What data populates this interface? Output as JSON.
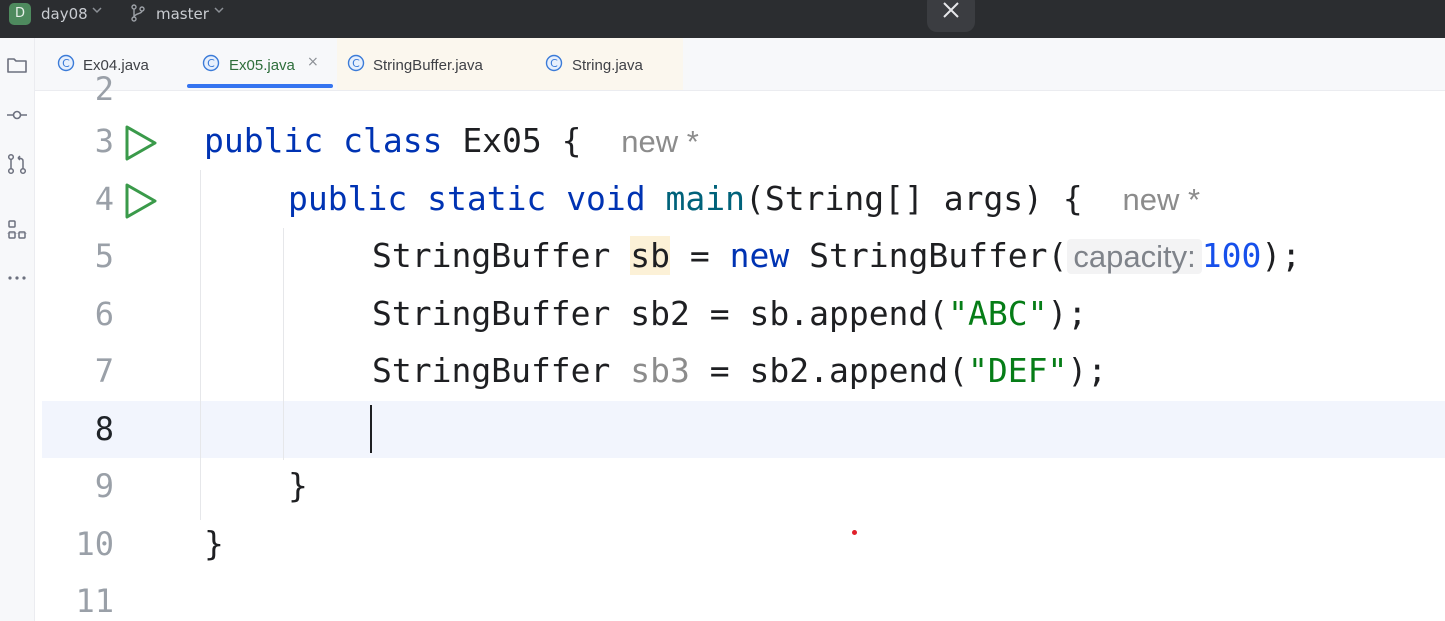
{
  "titlebar": {
    "project_badge": "D",
    "project_name": "day08",
    "branch_name": "master"
  },
  "tabs": [
    {
      "label": "Ex04.java",
      "active": false
    },
    {
      "label": "Ex05.java",
      "active": true,
      "close": "×"
    },
    {
      "label": "StringBuffer.java",
      "active": false
    },
    {
      "label": "String.java",
      "active": false
    }
  ],
  "gutter": {
    "line_numbers": [
      "2",
      "3",
      "4",
      "5",
      "6",
      "7",
      "8",
      "9",
      "10",
      "11"
    ],
    "current_line": "8"
  },
  "code": {
    "l3": {
      "kw1": "public",
      "kw2": "class",
      "name": "Ex05",
      "brace": "{",
      "hint": "new *"
    },
    "l4": {
      "kw1": "public",
      "kw2": "static",
      "kw3": "void",
      "fn": "main",
      "params": "(String[] args) {",
      "hint": "new *"
    },
    "l5": {
      "type": "StringBuffer",
      "var": "sb",
      "eq": " = ",
      "kw": "new",
      "ctor": " StringBuffer(",
      "param_hint": "capacity:",
      "num": "100",
      "end": ");"
    },
    "l6": {
      "pre": "StringBuffer sb2 = sb.append(",
      "str": "\"ABC\"",
      "end": ");"
    },
    "l7": {
      "type": "StringBuffer ",
      "var": "sb3",
      "mid": " = sb2.append(",
      "str": "\"DEF\"",
      "end": ");"
    },
    "l9": "}",
    "l10": "}"
  },
  "colors": {
    "keyword": "#0033b3",
    "string": "#067d17",
    "number": "#1750eb",
    "method": "#00627a",
    "active_tab_underline": "#3574f0",
    "run_icon": "#3a9a4a"
  },
  "icons": [
    "project-folder-icon",
    "commit-icon",
    "pull-requests-icon",
    "structure-icon",
    "more-icon",
    "run-gutter-icon",
    "java-class-icon",
    "branch-icon",
    "close-icon"
  ]
}
